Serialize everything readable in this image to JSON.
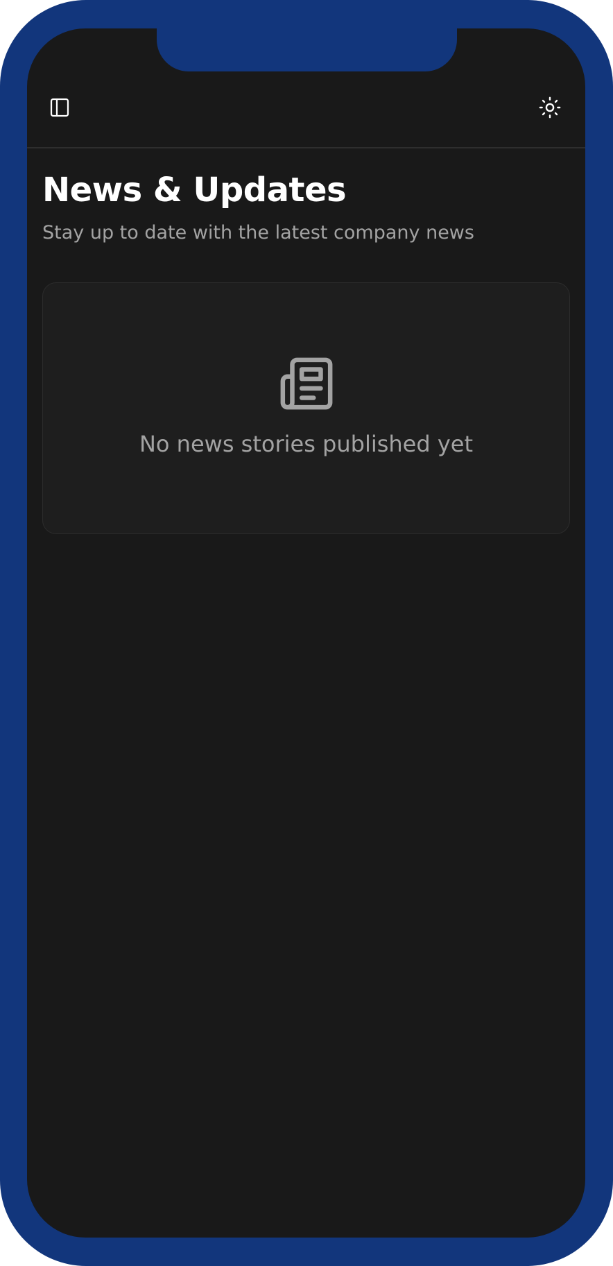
{
  "colors": {
    "device_frame": "#12367c",
    "screen_background": "#191919",
    "card_background": "#1e1e1e",
    "title_text": "#ffffff",
    "muted_text": "#a3a3a3"
  },
  "header": {
    "left_icon": "sidebar-toggle-icon",
    "right_icon": "sun-icon"
  },
  "page": {
    "title": "News & Updates",
    "subtitle": "Stay up to date with the latest company news"
  },
  "empty_state": {
    "icon": "newspaper-icon",
    "message": "No news stories published yet"
  }
}
